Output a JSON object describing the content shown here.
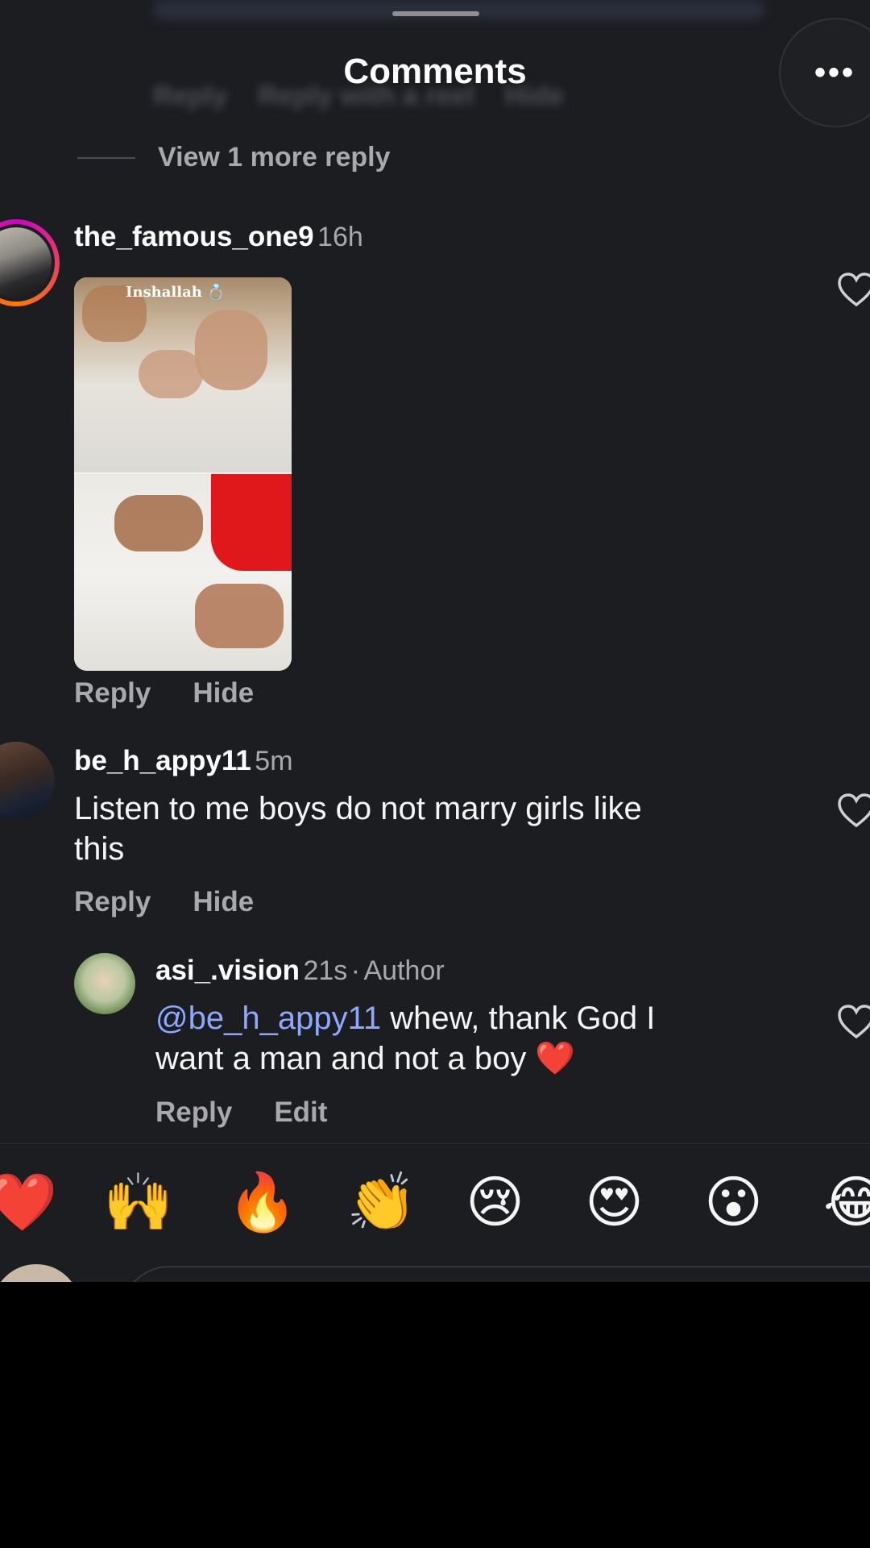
{
  "header": {
    "title": "Comments",
    "more_icon": "ellipsis-icon"
  },
  "view_more_replies": "View 1 more reply",
  "comments": [
    {
      "username": "the_famous_one9",
      "time": "16h",
      "media_overlay_text": "Inshallah 💍",
      "reply_label": "Reply",
      "hide_label": "Hide"
    },
    {
      "username": "be_h_appy11",
      "time": "5m",
      "text_line1": "Listen to me boys do not marry girls like",
      "text_line2": "this",
      "reply_label": "Reply",
      "hide_label": "Hide"
    },
    {
      "username": "asi_.vision",
      "time": "21s",
      "separator": "·",
      "badge": "Author",
      "mention": "@be_h_appy11",
      "text_part1": " whew, thank God I",
      "text_line2": "want a man and not a boy ❤️",
      "reply_label": "Reply",
      "edit_label": "Edit"
    }
  ],
  "emoji_bar": [
    "❤️",
    "🙌",
    "🔥",
    "👏",
    "😢",
    "😍",
    "😮",
    "😂"
  ],
  "colors": {
    "sheet_bg": "#1b1d21",
    "mention": "#8fa8ff",
    "muted": "#a8a8ad",
    "story_ring_start": "#d300c5",
    "story_ring_end": "#ff7a00"
  }
}
